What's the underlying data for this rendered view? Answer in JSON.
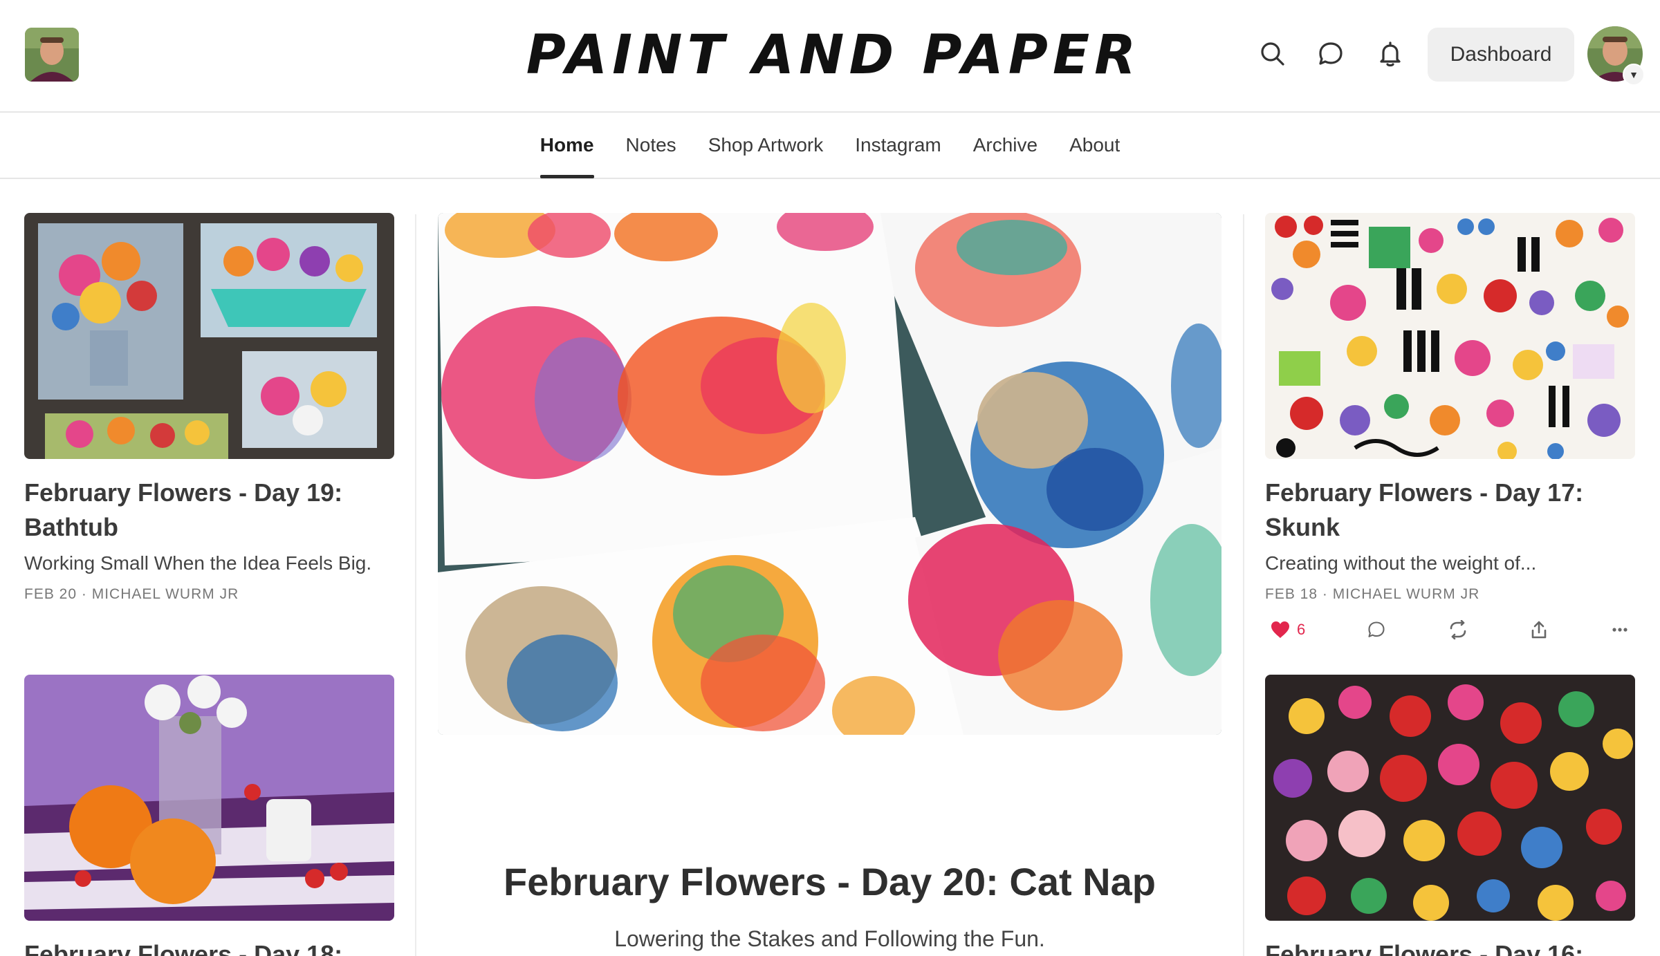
{
  "header": {
    "site_title": "PAINT AND PAPER",
    "dashboard_label": "Dashboard",
    "icons": [
      "search-icon",
      "chat-icon",
      "bell-icon"
    ]
  },
  "nav": {
    "tabs": [
      {
        "label": "Home",
        "active": true
      },
      {
        "label": "Notes",
        "active": false
      },
      {
        "label": "Shop Artwork",
        "active": false
      },
      {
        "label": "Instagram",
        "active": false
      },
      {
        "label": "Archive",
        "active": false
      },
      {
        "label": "About",
        "active": false
      }
    ]
  },
  "left_column": {
    "posts": [
      {
        "title": "February Flowers - Day 19: Bathtub",
        "subtitle": "Working Small When the Idea Feels Big.",
        "meta": "FEB 20 · MICHAEL WURM JR"
      },
      {
        "title": "February Flowers - Day 18:"
      }
    ]
  },
  "featured": {
    "title": "February Flowers - Day 20: Cat Nap",
    "subtitle": "Lowering the Stakes and Following the Fun."
  },
  "right_column": {
    "posts": [
      {
        "title": "February Flowers - Day 17: Skunk",
        "subtitle": "Creating without the weight of...",
        "meta": "FEB 18 · MICHAEL WURM JR",
        "likes": "6"
      },
      {
        "title": "February Flowers - Day 16:"
      }
    ]
  },
  "colors": {
    "accent_like": "#e2264d",
    "divider": "#e6e6e6",
    "text": "#2b2b2b"
  }
}
